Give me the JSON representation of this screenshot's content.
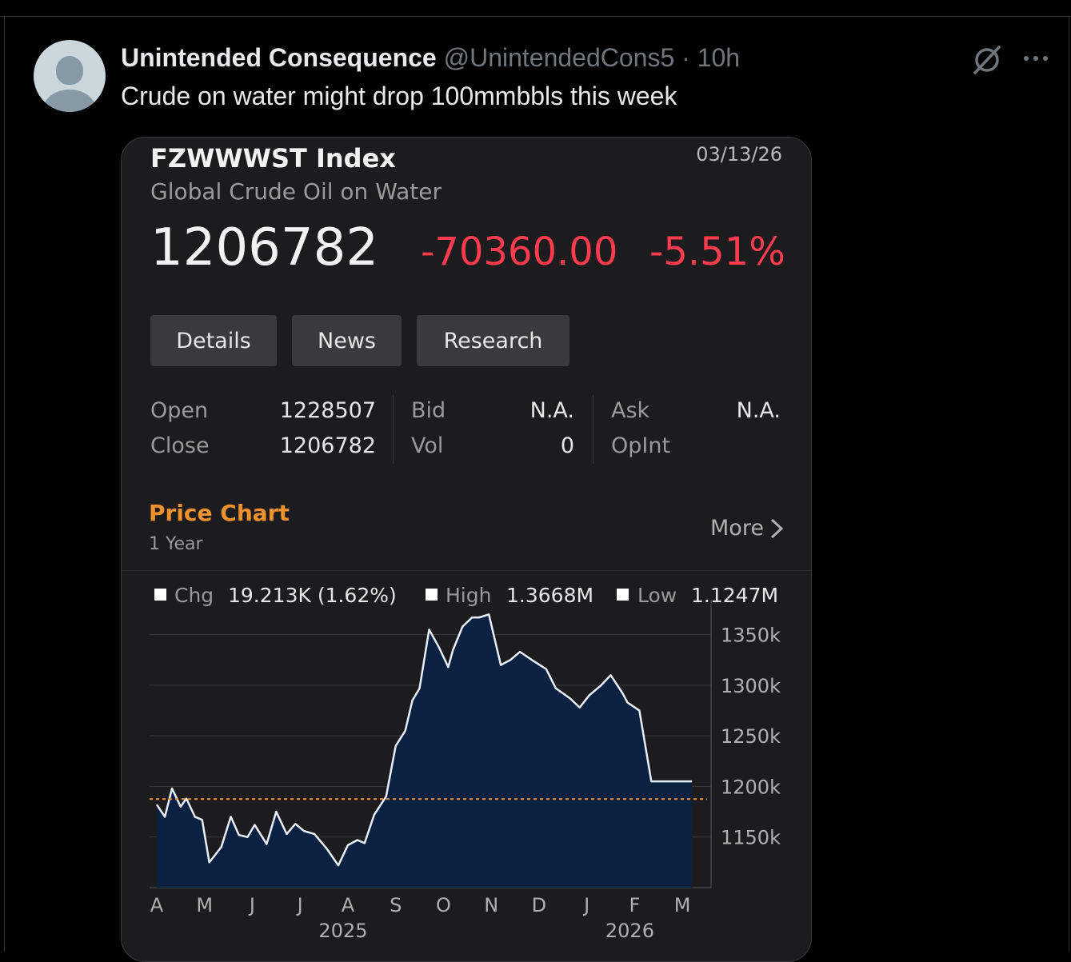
{
  "tweet": {
    "author_name": "Unintended Consequence",
    "handle": "@UnintendedCons5",
    "separator": "·",
    "time": "10h",
    "text": "Crude on water might drop 100mmbbls this week",
    "icons": [
      "grok-icon",
      "more-icon",
      "avatar-placeholder"
    ]
  },
  "card": {
    "ticker": "FZWWWST Index",
    "description": "Global Crude Oil on Water",
    "date": "03/13/26",
    "last": "1206782",
    "net_change": "-70360.00",
    "pct_change": "-5.51%",
    "change_color": "#ff3b4e",
    "buttons": [
      "Details",
      "News",
      "Research"
    ],
    "stats": {
      "open_label": "Open",
      "open_value": "1228507",
      "close_label": "Close",
      "close_value": "1206782",
      "bid_label": "Bid",
      "bid_value": "N.A.",
      "vol_label": "Vol",
      "vol_value": "0",
      "ask_label": "Ask",
      "ask_value": "N.A.",
      "opint_label": "OpInt"
    },
    "price_chart": {
      "title": "Price Chart",
      "title_color": "#f0922b",
      "range": "1 Year",
      "more": "More",
      "legend": {
        "chg_label": "Chg",
        "chg_value": "19.213K (1.62%)",
        "high_label": "High",
        "high_value": "1.3668M",
        "low_label": "Low",
        "low_value": "1.1247M"
      }
    }
  },
  "chart_data": {
    "type": "area",
    "ylim": [
      1100,
      1375
    ],
    "y_ticks": [
      1150,
      1200,
      1250,
      1300,
      1350
    ],
    "y_tick_labels": [
      "1150k",
      "1200k",
      "1250k",
      "1300k",
      "1350k"
    ],
    "x_tick_labels": [
      "A",
      "M",
      "J",
      "J",
      "A",
      "S",
      "O",
      "N",
      "D",
      "J",
      "F",
      "M"
    ],
    "x_year_labels": [
      "2025",
      "2026"
    ],
    "reference_line": 1187.5,
    "fill_color": "#0a2142",
    "line_color": "#e8eef8",
    "reference_color": "#f0922b",
    "grid": true,
    "x": [
      0,
      0.17,
      0.32,
      0.5,
      0.62,
      0.8,
      0.95,
      1.1,
      1.35,
      1.55,
      1.72,
      1.9,
      2.05,
      2.3,
      2.5,
      2.72,
      2.9,
      3.08,
      3.3,
      3.55,
      3.8,
      4.0,
      4.2,
      4.35,
      4.55,
      4.8,
      5.0,
      5.2,
      5.35,
      5.5,
      5.7,
      5.9,
      6.1,
      6.2,
      6.4,
      6.6,
      6.75,
      6.95,
      7.2,
      7.4,
      7.6,
      7.85,
      8.15,
      8.35,
      8.5,
      8.65,
      8.85,
      9.05,
      9.3,
      9.5,
      9.75,
      9.85,
      10.1,
      10.35,
      10.55,
      10.8,
      10.95,
      11.2
    ],
    "series": [
      {
        "values": [
          1182,
          1170,
          1198,
          1180,
          1188,
          1170,
          1167,
          1125,
          1140,
          1170,
          1152,
          1150,
          1162,
          1143,
          1175,
          1153,
          1163,
          1156,
          1153,
          1139,
          1122,
          1142,
          1147,
          1144,
          1172,
          1190,
          1240,
          1255,
          1285,
          1297,
          1355,
          1338,
          1318,
          1335,
          1358,
          1367,
          1367,
          1370,
          1320,
          1325,
          1333,
          1325,
          1316,
          1297,
          1292,
          1287,
          1278,
          1290,
          1300,
          1310,
          1292,
          1283,
          1275,
          1205,
          1205,
          1205,
          1205,
          1205
        ]
      }
    ]
  }
}
